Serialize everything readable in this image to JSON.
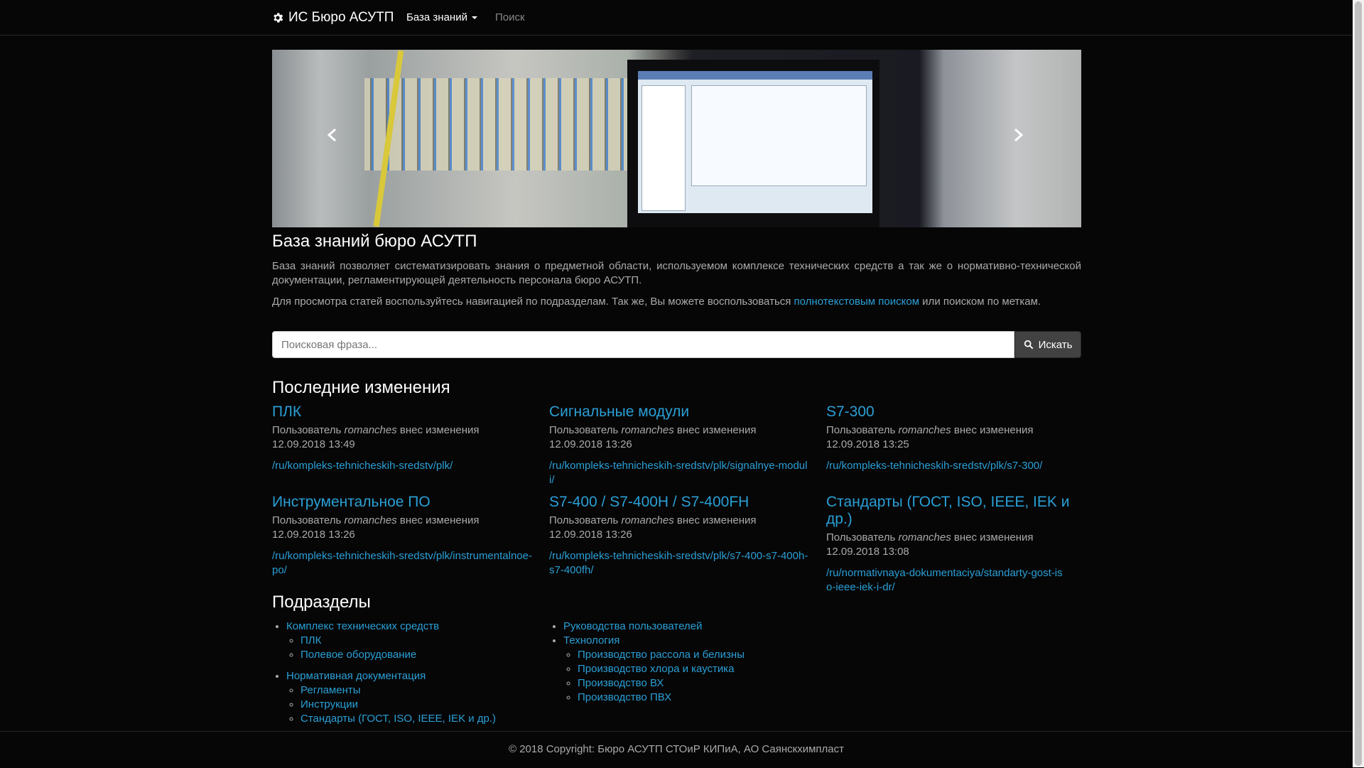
{
  "navbar": {
    "brand": "ИС Бюро АСУТП",
    "brand_icon": "gear-icon",
    "knowledge_base": "База знаний",
    "search": "Поиск"
  },
  "carousel": {
    "slides_count": 3,
    "active_index": 2
  },
  "intro": {
    "title": "База знаний бюро АСУТП",
    "paragraph1": "База знаний позволяет систематизировать знания о предметной области, используемом комплексе технических средств а так же о нормативно-технической документации, регламентирующей деятельность персонала бюро АСУТП.",
    "paragraph2_before": "Для просмотра статей воспользуйтесь навигацией по подразделам. Так же, Вы можете воспользоваться ",
    "paragraph2_link": "полнотекстовым поиском",
    "paragraph2_after": " или поиском по меткам."
  },
  "search": {
    "placeholder": "Поисковая фраза...",
    "button": "Искать"
  },
  "recent": {
    "heading": "Последние изменения",
    "user_prefix": "Пользователь",
    "user_suffix": "внес изменения",
    "items": [
      {
        "title": "ПЛК",
        "user": "romanches",
        "date": "12.09.2018 13:49",
        "path": "/ru/kompleks-tehnicheskih-sredstv/plk/"
      },
      {
        "title": "Сигнальные модули",
        "user": "romanches",
        "date": "12.09.2018 13:26",
        "path": "/ru/kompleks-tehnicheskih-sredstv/plk/signalnye-moduli/"
      },
      {
        "title": "S7-300",
        "user": "romanches",
        "date": "12.09.2018 13:25",
        "path": "/ru/kompleks-tehnicheskih-sredstv/plk/s7-300/"
      },
      {
        "title": "Инструментальное ПО",
        "user": "romanches",
        "date": "12.09.2018 13:26",
        "path": "/ru/kompleks-tehnicheskih-sredstv/plk/instrumentalnoe-po/"
      },
      {
        "title": "S7-400 / S7-400H / S7-400FH",
        "user": "romanches",
        "date": "12.09.2018 13:26",
        "path": "/ru/kompleks-tehnicheskih-sredstv/plk/s7-400-s7-400h-s7-400fh/"
      },
      {
        "title": "Стандарты (ГОСТ, ISO, IEEE, IEK и др.)",
        "user": "romanches",
        "date": "12.09.2018 13:08",
        "path": "/ru/normativnaya-dokumentaciya/standarty-gost-iso-ieee-iek-i-dr/"
      }
    ]
  },
  "sections": {
    "heading": "Подразделы",
    "col1": [
      {
        "label": "Комплекс технических средств",
        "children": [
          "ПЛК",
          "Полевое оборудование"
        ]
      },
      {
        "label": "Нормативная документация",
        "children": [
          "Регламенты",
          "Инструкции",
          "Стандарты (ГОСТ, ISO, IEEE, IEK и др.)"
        ]
      }
    ],
    "col2": [
      {
        "label": "Руководства пользователей",
        "children": []
      },
      {
        "label": "Технология",
        "children": [
          "Производство рассола и белизны",
          "Производство хлора и каустика",
          "Производство ВХ",
          "Производство ПВХ"
        ]
      }
    ]
  },
  "footer": {
    "text": "© 2018 Copyright: Бюро АСУТП СТОиР КИПиА, АО Саянскхимпласт"
  },
  "colors": {
    "background": "#060606",
    "link": "#2a9fd6",
    "text": "#aaaaaa",
    "heading": "#ffffff"
  }
}
